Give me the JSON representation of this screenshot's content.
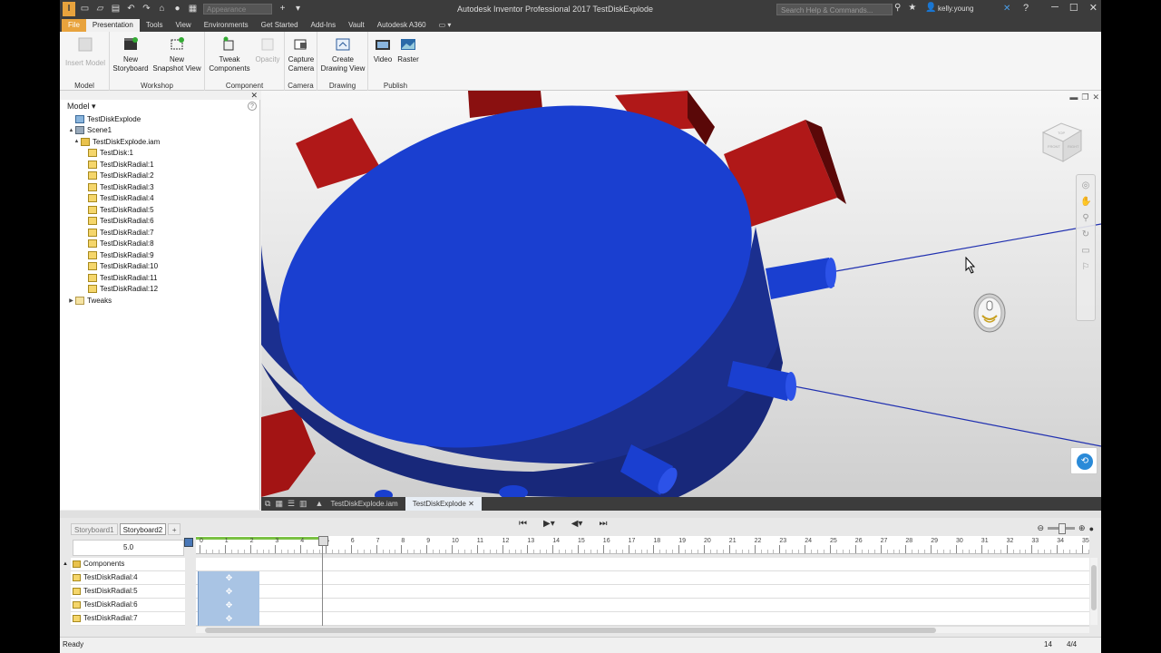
{
  "app": {
    "logo": "I",
    "title": "Autodesk Inventor Professional 2017   TestDiskExplode",
    "appearance_placeholder": "Appearance",
    "search_placeholder": "Search Help & Commands...",
    "user": "kelly.young"
  },
  "menu_tabs": [
    "File",
    "Presentation",
    "Tools",
    "View",
    "Environments",
    "Get Started",
    "Add-Ins",
    "Vault",
    "Autodesk A360"
  ],
  "ribbon": {
    "panels": [
      {
        "title": "Model",
        "buttons": [
          {
            "label": "Insert Model",
            "icon": "insert-model-icon",
            "enabled": false
          }
        ]
      },
      {
        "title": "Workshop",
        "buttons": [
          {
            "label": "New\nStoryboard",
            "icon": "storyboard-icon",
            "enabled": true
          },
          {
            "label": "New\nSnapshot View",
            "icon": "snapshot-icon",
            "enabled": true
          }
        ]
      },
      {
        "title": "Component",
        "buttons": [
          {
            "label": "Tweak\nComponents",
            "icon": "tweak-icon",
            "enabled": true
          },
          {
            "label": "Opacity",
            "icon": "opacity-icon",
            "enabled": false
          }
        ]
      },
      {
        "title": "Camera",
        "buttons": [
          {
            "label": "Capture\nCamera",
            "icon": "camera-icon",
            "enabled": true
          }
        ]
      },
      {
        "title": "Drawing",
        "buttons": [
          {
            "label": "Create\nDrawing View",
            "icon": "drawing-view-icon",
            "enabled": true
          }
        ]
      },
      {
        "title": "Publish",
        "buttons": [
          {
            "label": "Video",
            "icon": "video-icon",
            "enabled": true
          },
          {
            "label": "Raster",
            "icon": "raster-icon",
            "enabled": true
          }
        ]
      }
    ]
  },
  "browser": {
    "header": "Model",
    "tree": [
      {
        "label": "TestDiskExplode",
        "level": 0,
        "icon": "pres",
        "toggle": ""
      },
      {
        "label": "Scene1",
        "level": 1,
        "icon": "scene",
        "toggle": "▲"
      },
      {
        "label": "TestDiskExplode.iam",
        "level": 2,
        "icon": "asm",
        "toggle": "▲"
      },
      {
        "label": "TestDisk:1",
        "level": 3,
        "icon": "part",
        "toggle": ""
      },
      {
        "label": "TestDiskRadial:1",
        "level": 3,
        "icon": "part",
        "toggle": ""
      },
      {
        "label": "TestDiskRadial:2",
        "level": 3,
        "icon": "part",
        "toggle": ""
      },
      {
        "label": "TestDiskRadial:3",
        "level": 3,
        "icon": "part",
        "toggle": ""
      },
      {
        "label": "TestDiskRadial:4",
        "level": 3,
        "icon": "part",
        "toggle": ""
      },
      {
        "label": "TestDiskRadial:5",
        "level": 3,
        "icon": "part",
        "toggle": ""
      },
      {
        "label": "TestDiskRadial:6",
        "level": 3,
        "icon": "part",
        "toggle": ""
      },
      {
        "label": "TestDiskRadial:7",
        "level": 3,
        "icon": "part",
        "toggle": ""
      },
      {
        "label": "TestDiskRadial:8",
        "level": 3,
        "icon": "part",
        "toggle": ""
      },
      {
        "label": "TestDiskRadial:9",
        "level": 3,
        "icon": "part",
        "toggle": ""
      },
      {
        "label": "TestDiskRadial:10",
        "level": 3,
        "icon": "part",
        "toggle": ""
      },
      {
        "label": "TestDiskRadial:11",
        "level": 3,
        "icon": "part",
        "toggle": ""
      },
      {
        "label": "TestDiskRadial:12",
        "level": 3,
        "icon": "part",
        "toggle": ""
      },
      {
        "label": "Tweaks",
        "level": 1,
        "icon": "folder",
        "toggle": "▶"
      }
    ]
  },
  "viewport": {
    "viewcube_faces": [
      "FRONT",
      "RIGHT",
      "TOP"
    ],
    "colors": {
      "disk": "#1a3fd0",
      "disk_side": "#1b2f8f",
      "radial_block": "#b01818",
      "trail_line": "#2030b0"
    }
  },
  "document_tabs": [
    {
      "label": "TestDiskExplode.iam",
      "active": false
    },
    {
      "label": "TestDiskExplode",
      "active": true
    }
  ],
  "storyboard": {
    "tabs": [
      {
        "label": "Storyboard1",
        "active": false
      },
      {
        "label": "Storyboard2",
        "active": true
      }
    ],
    "add_tab": "+",
    "current_time": "5.0",
    "ruler_ticks": [
      "0",
      "1",
      "2",
      "3",
      "4",
      "5",
      "6",
      "7",
      "8",
      "9",
      "10",
      "11",
      "12",
      "13",
      "14",
      "15",
      "16",
      "17",
      "18",
      "19",
      "20",
      "21",
      "22",
      "23",
      "24",
      "25",
      "26",
      "27",
      "28",
      "29",
      "30",
      "31",
      "32",
      "33",
      "34",
      "35"
    ],
    "tracks": [
      {
        "label": "Components",
        "icon": "asm",
        "toggle": "▲",
        "action": false
      },
      {
        "label": "TestDiskRadial:4",
        "icon": "part",
        "toggle": "",
        "action": true
      },
      {
        "label": "TestDiskRadial:5",
        "icon": "part",
        "toggle": "",
        "action": true
      },
      {
        "label": "TestDiskRadial:6",
        "icon": "part",
        "toggle": "",
        "action": true
      },
      {
        "label": "TestDiskRadial:7",
        "icon": "part",
        "toggle": "",
        "action": true
      }
    ],
    "action_icon": "✥"
  },
  "status": {
    "text": "Ready",
    "count1": "14",
    "count2": "4/4"
  }
}
